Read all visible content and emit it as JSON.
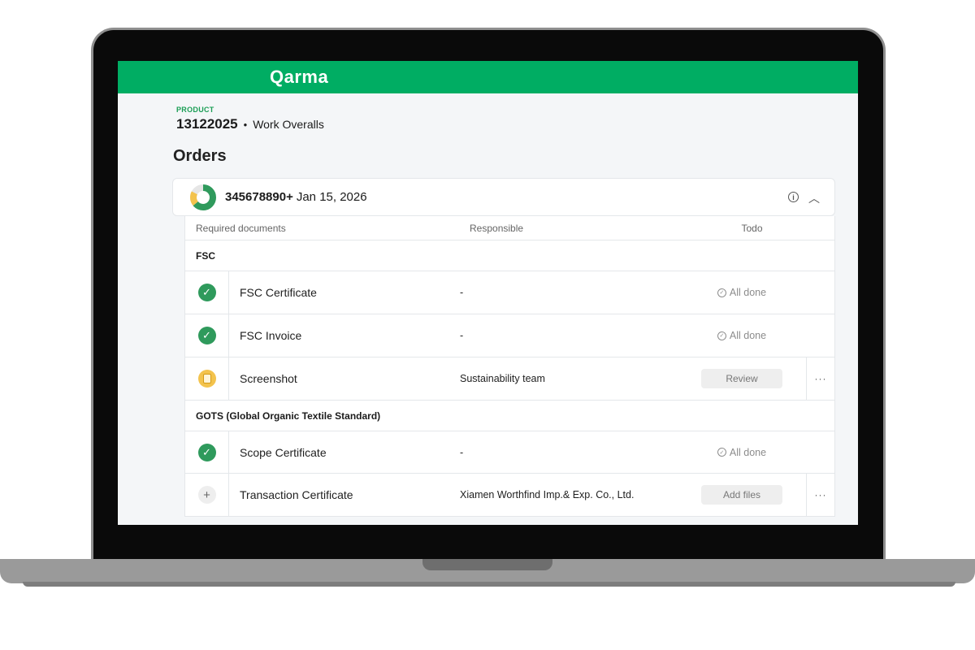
{
  "brand": {
    "logo": "Qarma",
    "accent": "#00ad63"
  },
  "product": {
    "label": "PRODUCT",
    "id": "13122025",
    "separator": "•",
    "name": "Work Overalls"
  },
  "page_title": "Orders",
  "order": {
    "id": "345678890+",
    "date": "Jan 15, 2026",
    "info_icon": "info-icon",
    "toggle_icon": "chevron-up-icon"
  },
  "table": {
    "headers": {
      "documents": "Required documents",
      "responsible": "Responsible",
      "todo": "Todo"
    },
    "groups": [
      {
        "title": "FSC",
        "rows": [
          {
            "status": "done",
            "name": "FSC Certificate",
            "responsible": "-",
            "todo": "All done"
          },
          {
            "status": "done",
            "name": "FSC Invoice",
            "responsible": "-",
            "todo": "All done"
          },
          {
            "status": "pending",
            "name": "Screenshot",
            "responsible": "Sustainability team",
            "todo": "Review",
            "more": "···"
          }
        ]
      },
      {
        "title": "GOTS (Global Organic Textile Standard)",
        "rows": [
          {
            "status": "done",
            "name": "Scope Certificate",
            "responsible": "-",
            "todo": "All done"
          },
          {
            "status": "empty",
            "name": "Transaction Certificate",
            "responsible": "Xiamen Worthfind Imp.& Exp. Co., Ltd.",
            "todo": "Add files",
            "more": "···"
          }
        ]
      }
    ]
  }
}
